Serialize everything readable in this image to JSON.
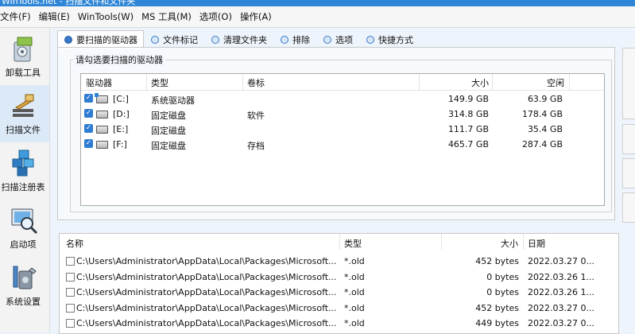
{
  "window": {
    "title": "WinTools.net - 扫描文件和文件夹"
  },
  "menu": [
    "文件(F)",
    "编辑(E)",
    "WinTools(W)",
    "MS 工具(M)",
    "选项(O)",
    "操作(A)"
  ],
  "sidebar": {
    "items": [
      {
        "label": "卸载工具",
        "icon": "uninstall-icon"
      },
      {
        "label": "扫描文件",
        "icon": "broom-scan-icon",
        "active": true
      },
      {
        "label": "扫描注册表",
        "icon": "registry-cubes-icon"
      },
      {
        "label": "启动项",
        "icon": "startup-magnifier-icon"
      },
      {
        "label": "系统设置",
        "icon": "system-tools-icon"
      }
    ]
  },
  "tabs": [
    {
      "label": "要扫描的驱动器",
      "active": true
    },
    {
      "label": "文件标记"
    },
    {
      "label": "清理文件夹"
    },
    {
      "label": "排除"
    },
    {
      "label": "选项"
    },
    {
      "label": "快捷方式"
    }
  ],
  "drives_group": {
    "title": "请勾选要扫描的驱动器",
    "columns": [
      "驱动器",
      "类型",
      "卷标",
      "大小",
      "空闲"
    ],
    "rows": [
      {
        "drive": "[C:]",
        "type": "系统驱动器",
        "label": "",
        "size": "149.9 GB",
        "free": "63.9 GB",
        "checked": true,
        "system": true
      },
      {
        "drive": "[D:]",
        "type": "固定磁盘",
        "label": "软件",
        "size": "314.8 GB",
        "free": "178.4 GB",
        "checked": true
      },
      {
        "drive": "[E:]",
        "type": "固定磁盘",
        "label": "",
        "size": "111.7 GB",
        "free": "35.4 GB",
        "checked": true
      },
      {
        "drive": "[F:]",
        "type": "固定磁盘",
        "label": "存档",
        "size": "465.7 GB",
        "free": "287.4 GB",
        "checked": true
      }
    ]
  },
  "results": {
    "columns": [
      "名称",
      "类型",
      "大小",
      "日期"
    ],
    "rows": [
      {
        "name": "C:\\Users\\Administrator\\AppData\\Local\\Packages\\Microsoft...",
        "type": "*.old",
        "size": "452 bytes",
        "date": "2022.03.27 0..."
      },
      {
        "name": "C:\\Users\\Administrator\\AppData\\Local\\Packages\\Microsoft...",
        "type": "*.old",
        "size": "0 bytes",
        "date": "2022.03.26 1..."
      },
      {
        "name": "C:\\Users\\Administrator\\AppData\\Local\\Packages\\Microsoft...",
        "type": "*.old",
        "size": "0 bytes",
        "date": "2022.03.26 1..."
      },
      {
        "name": "C:\\Users\\Administrator\\AppData\\Local\\Packages\\Microsoft...",
        "type": "*.old",
        "size": "452 bytes",
        "date": "2022.03.27 0..."
      },
      {
        "name": "C:\\Users\\Administrator\\AppData\\Local\\Packages\\Microsoft...",
        "type": "*.old",
        "size": "449 bytes",
        "date": "2022.03.27 0..."
      }
    ]
  },
  "colors": {
    "accent": "#2f86d6",
    "checkbox": "#2f7cd3",
    "active_side": "#dceaf8"
  }
}
